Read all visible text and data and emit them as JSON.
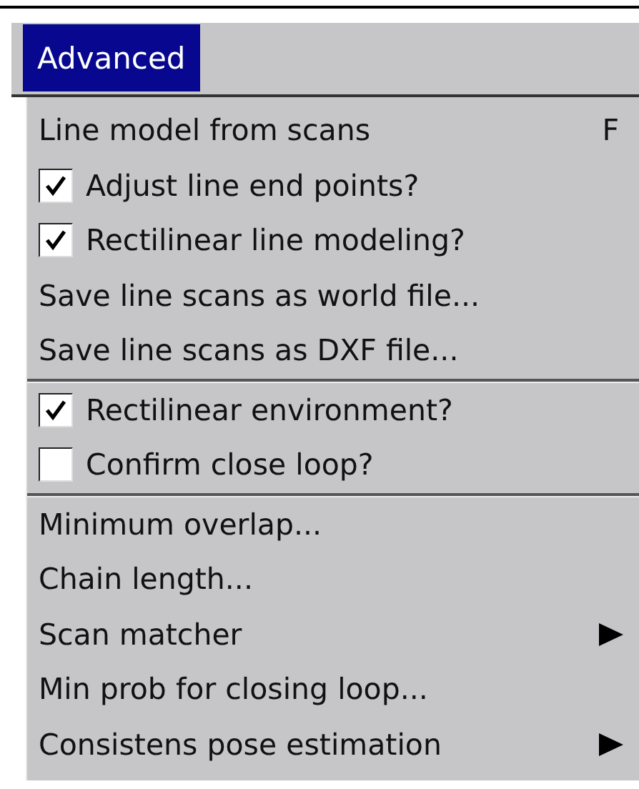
{
  "menubar": [
    {
      "label": "Advanced",
      "selected": true
    }
  ],
  "menu": {
    "groups": [
      {
        "items": [
          {
            "kind": "action",
            "label": "Line model from scans",
            "shortcut": "F"
          },
          {
            "kind": "check",
            "label": "Adjust line end points?",
            "checked": true
          },
          {
            "kind": "check",
            "label": "Rectilinear line modeling?",
            "checked": true
          },
          {
            "kind": "action",
            "label": "Save line scans as world file..."
          },
          {
            "kind": "action",
            "label": "Save line scans as DXF file..."
          }
        ]
      },
      {
        "items": [
          {
            "kind": "check",
            "label": "Rectilinear environment?",
            "checked": true
          },
          {
            "kind": "check",
            "label": "Confirm close loop?",
            "checked": false
          }
        ]
      },
      {
        "items": [
          {
            "kind": "action",
            "label": "Minimum overlap..."
          },
          {
            "kind": "action",
            "label": "Chain length..."
          },
          {
            "kind": "submenu",
            "label": "Scan matcher"
          },
          {
            "kind": "action",
            "label": "Min prob for closing loop..."
          },
          {
            "kind": "submenu",
            "label": "Consistens pose estimation"
          }
        ]
      }
    ]
  }
}
